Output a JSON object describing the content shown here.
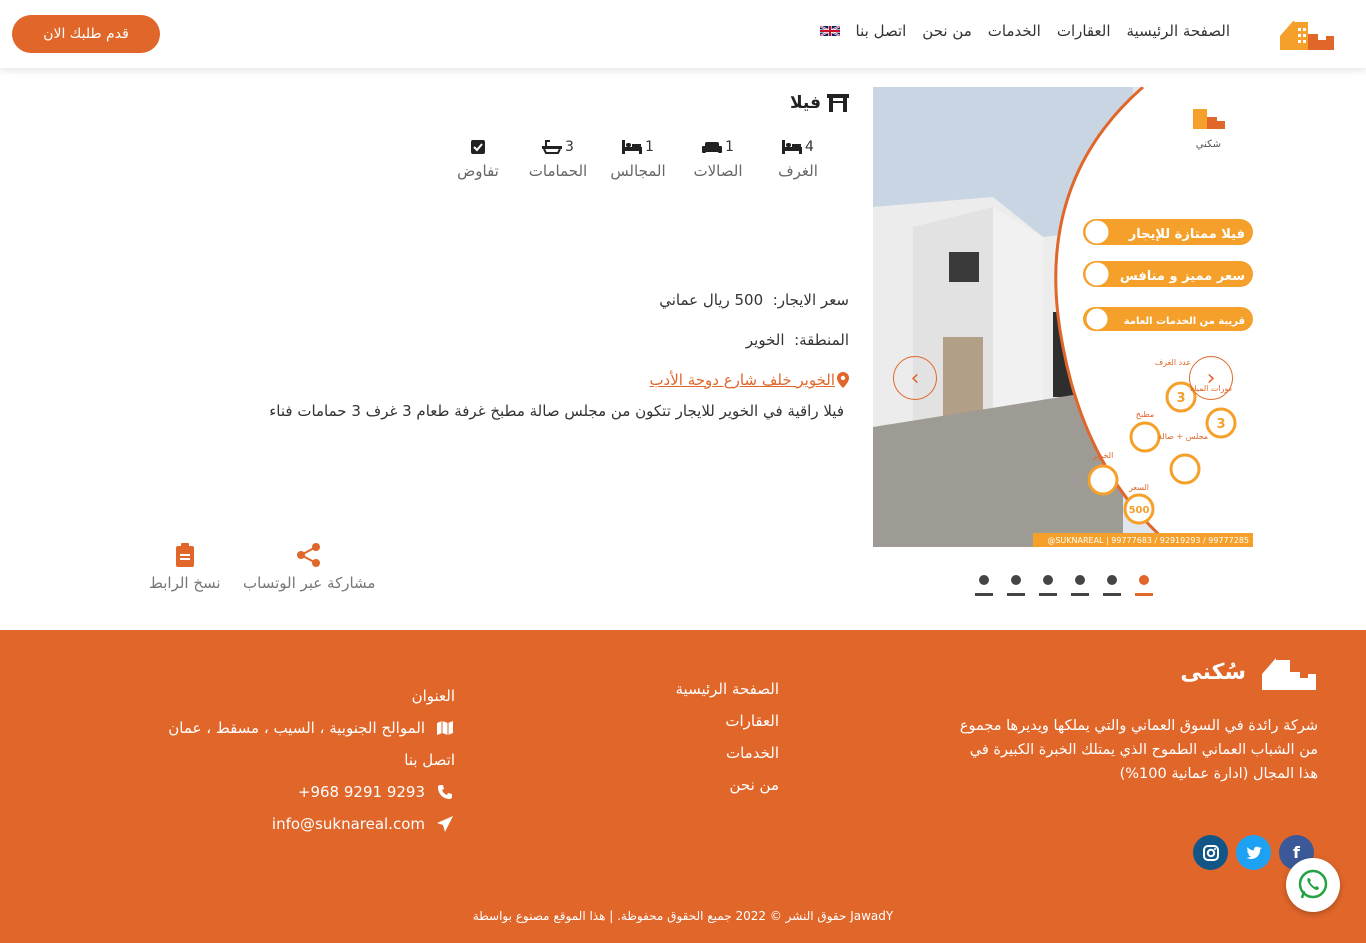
{
  "header": {
    "cta_label": "قدم طلبك الان",
    "nav": [
      "الصفحة الرئيسية",
      "العقارات",
      "الخدمات",
      "من نحن",
      "اتصل بنا"
    ],
    "language_icon": "uk-flag-icon"
  },
  "property": {
    "type": "فيلا",
    "stats": [
      {
        "value": "4",
        "label": "الغرف",
        "icon": "bed-icon"
      },
      {
        "value": "1",
        "label": "الصالات",
        "icon": "sofa-icon"
      },
      {
        "value": "1",
        "label": "المجالس",
        "icon": "bed-icon"
      },
      {
        "value": "3",
        "label": "الحمامات",
        "icon": "bath-icon"
      },
      {
        "value": "",
        "label": "تفاوض",
        "icon": "checkbox-icon"
      }
    ],
    "rent_label": "سعر الايجار:",
    "rent_value": "500 ريال عماني",
    "area_label": "المنطقة:",
    "area_value": "الخوير",
    "location_link": "الخوير خلف شارع دوحة الأدب",
    "description": "فيلا راقية في الخوير للايجار تتكون من مجلس صالة مطبخ غرفة طعام 3 غرف 3 حمامات فناء",
    "share_whatsapp": "مشاركة عبر الوتساب",
    "copy_link": "نسخ الرابط"
  },
  "slider": {
    "slide_count": 6,
    "active_index": 5,
    "banner_lines": [
      "فيلا ممتازة للإيجار",
      "سعر مميز و منافس",
      "قريبة من الخدمات العامة"
    ],
    "circle_labels": [
      {
        "label": "عدد الغرف",
        "value": "3"
      },
      {
        "label": "دورات المياه",
        "value": "3"
      },
      {
        "label": "مطبخ",
        "value": ""
      },
      {
        "label": "مجلس + صالة",
        "value": ""
      },
      {
        "label": "الخوير",
        "value": ""
      },
      {
        "label": "السعر",
        "value": "500"
      }
    ],
    "contact_strip": "@SUKNAREAL | 99777683 / 92919293 / 99777285",
    "logo_text": "شكني"
  },
  "footer": {
    "brand_name": "سُكنى",
    "about": "شركة رائدة في السوق العماني والتي يملكها ويديرها مجموع من الشباب العماني الطموح الذي يمتلك الخبرة الكبيرة في هذا المجال (ادارة عمانية 100%)",
    "links": [
      "الصفحة الرئيسية",
      "العقارات",
      "الخدمات",
      "من نحن"
    ],
    "address_title": "العنوان",
    "address": "الموالح الجنوبية ، السيب ، مسقط ، عمان",
    "contact_title": "اتصل بنا",
    "phone": "+968 9291 9293",
    "email": "info@suknareal.com",
    "copyright": "حقوق النشر © 2022 جميع الحقوق محفوظة. | هذا الموقع مصنوع بواسطة JawadY",
    "social": [
      "facebook-icon",
      "twitter-icon",
      "instagram-icon"
    ],
    "colors": {
      "accent": "#e0662a",
      "facebook": "#3b5998",
      "twitter": "#1da1f2",
      "instagram": "#125688"
    }
  }
}
